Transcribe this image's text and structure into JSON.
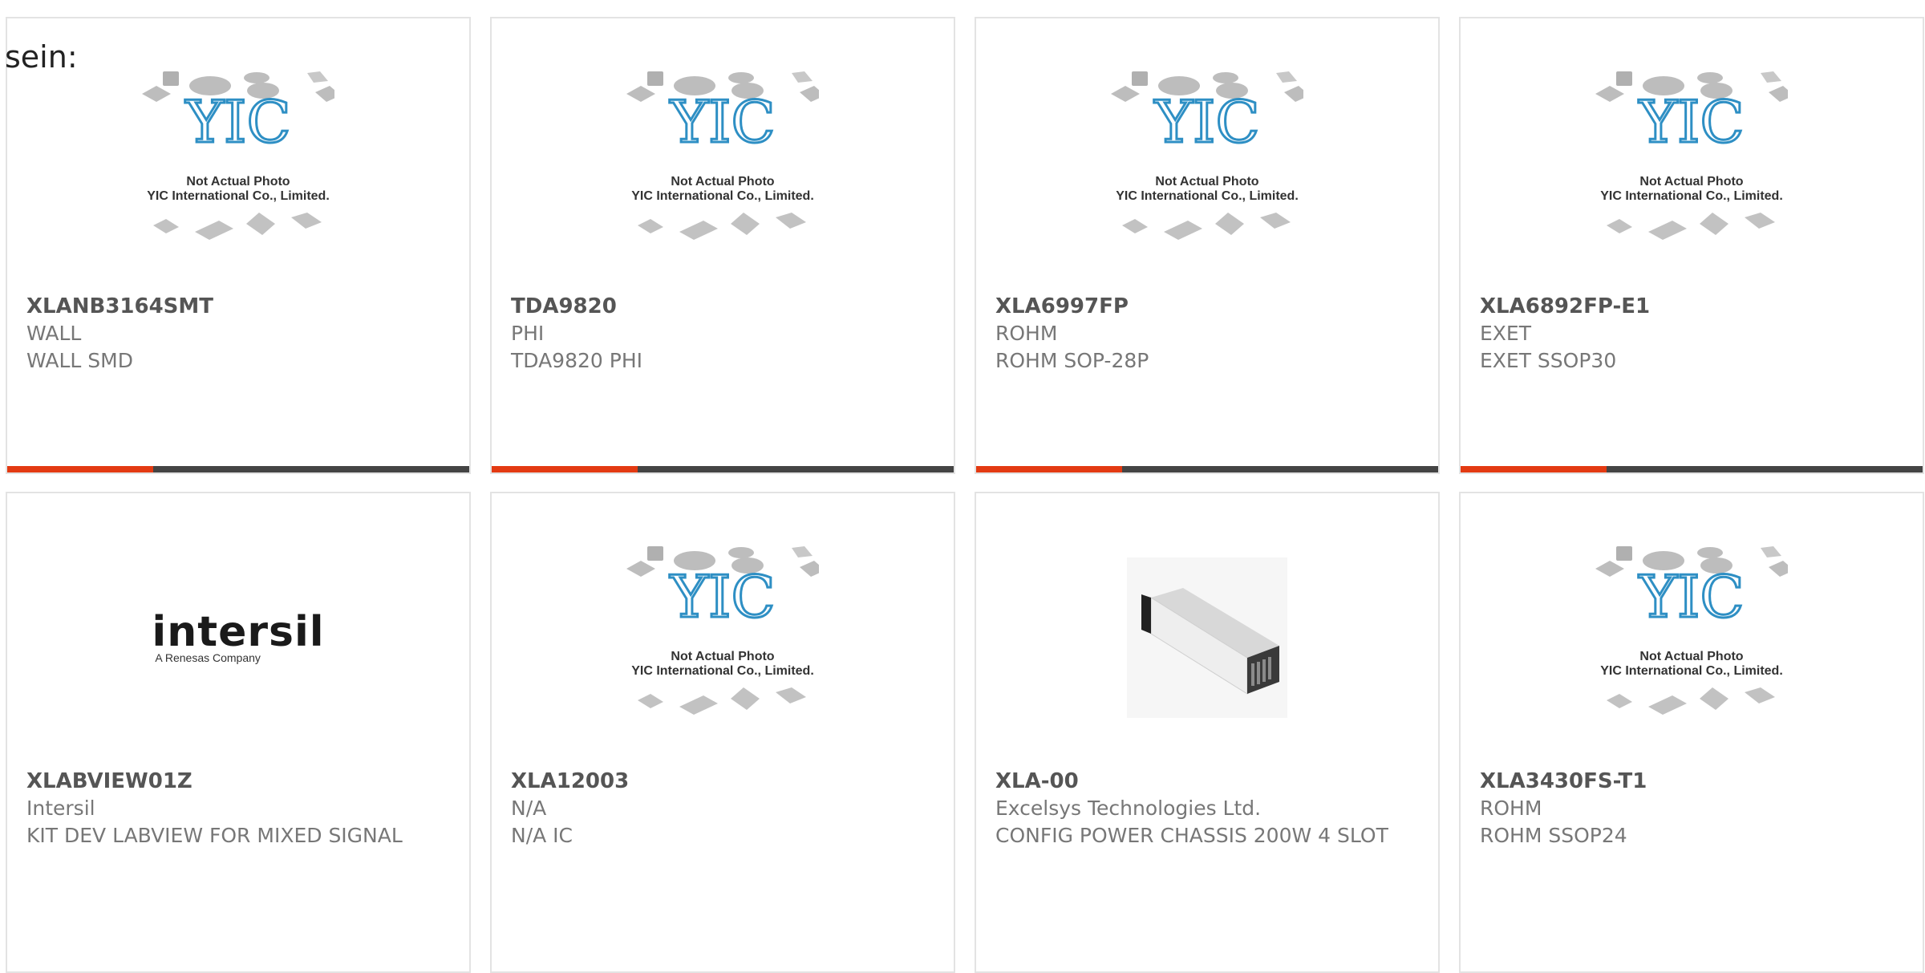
{
  "page": {
    "stray_text": "sein:"
  },
  "placeholder": {
    "line1": "Not Actual Photo",
    "line2": "YIC International Co., Limited."
  },
  "intersil_logo": {
    "word": "intersil",
    "tagline": "A Renesas Company"
  },
  "colors": {
    "accent": "#e33a12",
    "bar": "#444444",
    "logo_blue": "#2e8fc4"
  },
  "products": [
    {
      "part_number": "XLANB3164SMT",
      "manufacturer": "WALL",
      "description": "WALL SMD",
      "image": "placeholder"
    },
    {
      "part_number": "TDA9820",
      "manufacturer": "PHI",
      "description": "TDA9820 PHI",
      "image": "placeholder"
    },
    {
      "part_number": "XLA6997FP",
      "manufacturer": "ROHM",
      "description": "ROHM SOP-28P",
      "image": "placeholder"
    },
    {
      "part_number": "XLA6892FP-E1",
      "manufacturer": "EXET",
      "description": "EXET SSOP30",
      "image": "placeholder"
    },
    {
      "part_number": "XLABVIEW01Z",
      "manufacturer": "Intersil",
      "description": "KIT DEV LABVIEW FOR MIXED SIGNAL",
      "image": "intersil-logo"
    },
    {
      "part_number": "XLA12003",
      "manufacturer": "N/A",
      "description": "N/A IC",
      "image": "placeholder"
    },
    {
      "part_number": "XLA-00",
      "manufacturer": "Excelsys Technologies Ltd.",
      "description": "CONFIG POWER CHASSIS 200W 4 SLOT",
      "image": "power-chassis-photo"
    },
    {
      "part_number": "XLA3430FS-T1",
      "manufacturer": "ROHM",
      "description": "ROHM SSOP24",
      "image": "placeholder"
    }
  ]
}
